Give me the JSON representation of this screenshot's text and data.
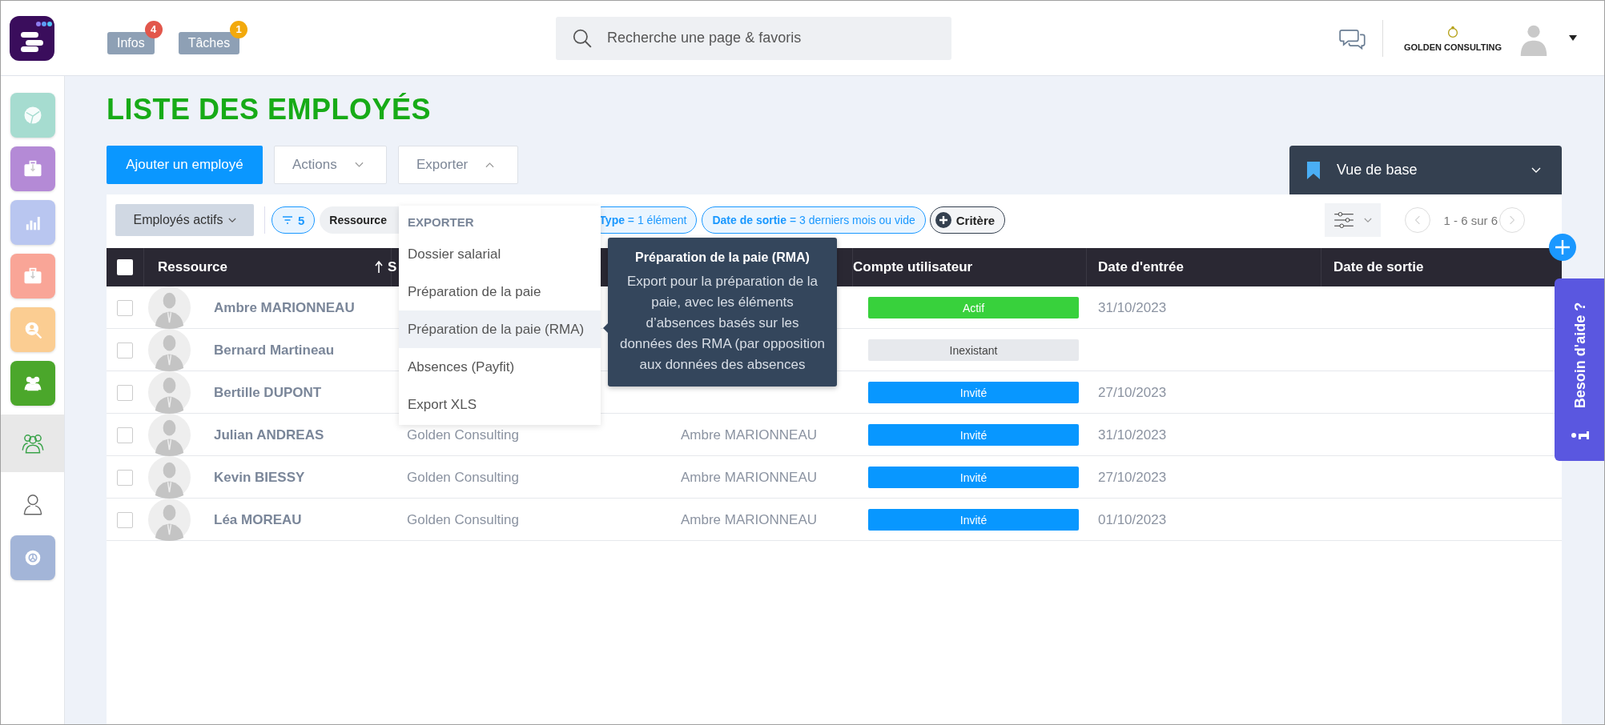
{
  "header": {
    "notifications": [
      {
        "label": "Infos",
        "count": "4",
        "color": "#e2574c"
      },
      {
        "label": "Tâches",
        "count": "1",
        "color": "#f2a90c"
      }
    ],
    "search": {
      "placeholder": "Recherche une page & favoris"
    },
    "company": "GOLDEN CONSULTING"
  },
  "sidebar": {
    "items": [
      {
        "kind": "tile",
        "color": "#a6dcd0",
        "selected": false
      },
      {
        "kind": "tile",
        "color": "#b48ad6",
        "selected": false
      },
      {
        "kind": "tile",
        "color": "#b9c6f0",
        "selected": false
      },
      {
        "kind": "tile",
        "color": "#f9a597",
        "selected": false
      },
      {
        "kind": "tile",
        "color": "#fbcd92",
        "selected": false
      },
      {
        "kind": "tile",
        "color": "#4ba72b",
        "selected": false
      },
      {
        "kind": "plain",
        "selected": true
      },
      {
        "kind": "plain",
        "selected": false
      },
      {
        "kind": "tile",
        "color": "#a3b5d8",
        "selected": false
      }
    ]
  },
  "page": {
    "title": "LISTE DES EMPLOYÉS"
  },
  "toolbar": {
    "primary": "Ajouter un employé",
    "menus": [
      {
        "label": "Actions",
        "expanded": false
      },
      {
        "label": "Exporter",
        "expanded": true
      }
    ]
  },
  "view": {
    "label": "Vue de base"
  },
  "filters": {
    "preset": "Employés actifs",
    "count": "5",
    "chips": [
      {
        "kind": "plain",
        "text": "Ressource"
      },
      {
        "kind": "active",
        "text": "**Type** = 1 élément"
      },
      {
        "kind": "active",
        "text": "**Date de sortie** = 3 derniers mois ou vide"
      }
    ],
    "add": "Critère"
  },
  "pagination": "1 - 6 sur 6",
  "table": {
    "all_checked": false,
    "columns": [
      {
        "label": "Ressource",
        "sorted": true
      },
      {
        "label": "S",
        "sorted": false
      },
      {
        "label": "Compte utilisateur",
        "sorted": false
      },
      {
        "label": "Date d'entrée",
        "sorted": false
      },
      {
        "label": "Date de sortie",
        "sorted": false
      }
    ],
    "rows": [
      {
        "selected": false,
        "name": "Ambre MARIONNEAU",
        "account": {
          "label": "Actif",
          "kind": "active"
        },
        "entry_date": "31/10/2023"
      },
      {
        "selected": false,
        "name": "Bernard Martineau",
        "account": {
          "label": "Inexistant",
          "kind": "none"
        }
      },
      {
        "selected": false,
        "name": "Bertille DUPONT",
        "account": {
          "label": "Invité",
          "kind": "invited"
        },
        "entry_date": "27/10/2023"
      },
      {
        "selected": false,
        "name": "Julian ANDREAS",
        "company": "Golden Consulting",
        "manager": "Ambre MARIONNEAU",
        "account": {
          "label": "Invité",
          "kind": "invited"
        },
        "entry_date": "31/10/2023"
      },
      {
        "selected": false,
        "name": "Kevin BIESSY",
        "company": "Golden Consulting",
        "manager": "Ambre MARIONNEAU",
        "account": {
          "label": "Invité",
          "kind": "invited"
        },
        "entry_date": "27/10/2023"
      },
      {
        "selected": false,
        "name": "Léa MOREAU",
        "company": "Golden Consulting",
        "manager": "Ambre MARIONNEAU",
        "account": {
          "label": "Invité",
          "kind": "invited"
        },
        "entry_date": "01/10/2023"
      }
    ]
  },
  "export_menu": {
    "heading": "EXPORTER",
    "items": [
      {
        "label": "Dossier salarial",
        "selected": false
      },
      {
        "label": "Préparation de la paie",
        "selected": false
      },
      {
        "label": "Préparation de la paie (RMA)",
        "selected": true
      },
      {
        "label": "Absences (Payfit)",
        "selected": false
      },
      {
        "label": "Export XLS",
        "selected": false
      }
    ]
  },
  "tooltip": {
    "title": "Préparation de la paie (RMA)",
    "text": "Export pour la préparation de la paie, avec les éléments d’absences basés sur les données des RMA (par opposition aux données des absences"
  },
  "help_tab": "Besoin d'aide ?"
}
